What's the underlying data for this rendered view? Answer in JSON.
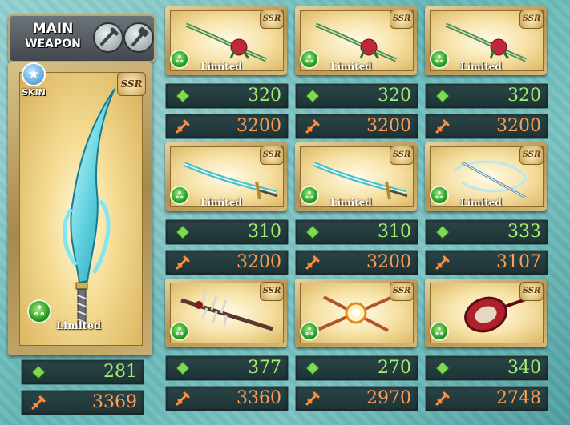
{
  "main_weapon": {
    "header": {
      "line1": "MAIN",
      "line2": "WEAPON"
    },
    "skin_label": "SKIN",
    "rarity": "SSR",
    "tag": "Limited",
    "hp": "281",
    "atk": "3369"
  },
  "weapons": [
    {
      "rarity": "SSR",
      "tag": "Limited",
      "hp": "320",
      "atk": "3200"
    },
    {
      "rarity": "SSR",
      "tag": "Limited",
      "hp": "320",
      "atk": "3200"
    },
    {
      "rarity": "SSR",
      "tag": "Limited",
      "hp": "320",
      "atk": "3200"
    },
    {
      "rarity": "SSR",
      "tag": "Limited",
      "hp": "310",
      "atk": "3200"
    },
    {
      "rarity": "SSR",
      "tag": "Limited",
      "hp": "310",
      "atk": "3200"
    },
    {
      "rarity": "SSR",
      "tag": "Limited",
      "hp": "333",
      "atk": "3107"
    },
    {
      "rarity": "SSR",
      "hp": "377",
      "atk": "3360"
    },
    {
      "rarity": "SSR",
      "hp": "270",
      "atk": "2970"
    },
    {
      "rarity": "SSR",
      "hp": "340",
      "atk": "2748"
    }
  ],
  "colors": {
    "hp_text": "#a4ef71",
    "atk_text": "#ff9c55",
    "background": "#78c2c1"
  }
}
